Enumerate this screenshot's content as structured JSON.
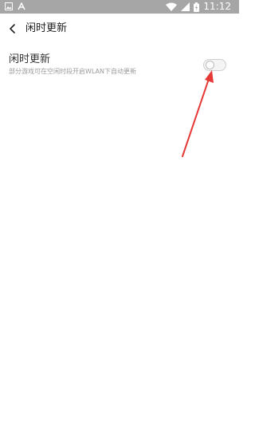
{
  "status_bar": {
    "time": "11:12",
    "icons": [
      "image-icon",
      "font-a-icon",
      "wifi-icon",
      "signal-icon",
      "battery-icon"
    ]
  },
  "header": {
    "back_icon": "chevron-left-icon",
    "title": "闲时更新"
  },
  "setting": {
    "title": "闲时更新",
    "description": "部分游戏可在空闲时段开启WLAN下自动更新",
    "toggle_state": "off"
  },
  "annotation": {
    "color": "#e53935",
    "icon": "red-arrow"
  },
  "colors": {
    "status_bar_bg": "#a6a6a6",
    "background": "#ffffff"
  }
}
